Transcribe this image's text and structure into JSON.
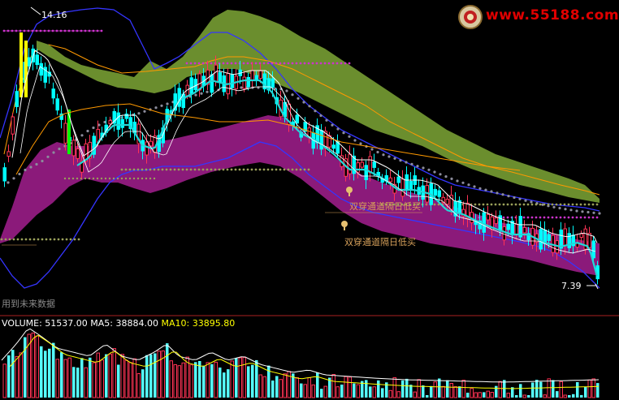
{
  "watermark": {
    "text": "www.55188.com"
  },
  "price_chart": {
    "max_label": "14.16",
    "min_label": "7.39",
    "future_data_note": "用到未来数据",
    "signal_label": "双穿通道隔日低买",
    "colors": {
      "up_candle": "#ff3355",
      "down_candle": "#00ffff",
      "upper_band": "#6b8e2e",
      "lower_band": "#8b1a7a",
      "bollinger": "#3535ff",
      "ma_white": "#ffffff",
      "ma_orange": "#ff9900",
      "magenta_dotted": "#cc33cc",
      "gray_dotted": "#8c8c9c",
      "olive_dotted": "#9aa05a",
      "signal_text": "#d6a05a"
    }
  },
  "volume_chart": {
    "volume_label": "VOLUME:",
    "volume_value": "51537.00",
    "ma5_label": "MA5:",
    "ma5_value": "38884.00",
    "ma10_label": "MA10:",
    "ma10_value": "33895.80",
    "colors": {
      "volume": "#ffffff",
      "ma5": "#ffffff",
      "ma10": "#ffff00"
    }
  }
}
